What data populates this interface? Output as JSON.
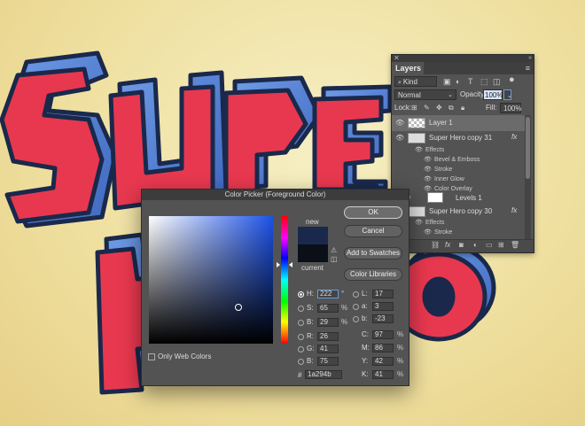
{
  "canvas": {
    "background_color": "#f2e4a8",
    "artwork": "3d-super-hero-text-graphic"
  },
  "layers_panel": {
    "tab": "Layers",
    "kind_label": "Kind",
    "blend_mode": "Normal",
    "opacity_label": "Opacity:",
    "opacity_value": "100%",
    "lock_label": "Lock:",
    "fill_label": "Fill:",
    "fill_value": "100%",
    "layers": [
      {
        "name": "Layer 1",
        "selected": true
      },
      {
        "name": "Super Hero copy 31",
        "fx": "fx"
      },
      {
        "name": "Levels 1"
      },
      {
        "name": "Super Hero copy 30",
        "fx": "fx"
      }
    ],
    "effects_label": "Effects",
    "effects_31": [
      "Bevel & Emboss",
      "Stroke",
      "Inner Glow",
      "Color Overlay"
    ],
    "effects_30": [
      "Stroke"
    ]
  },
  "color_picker": {
    "title": "Color Picker (Foreground Color)",
    "new_label": "new",
    "current_label": "current",
    "new_color": "#1a294b",
    "current_color": "#0a0f18",
    "buttons": {
      "ok": "OK",
      "cancel": "Cancel",
      "add_to_swatches": "Add to Swatches",
      "color_libraries": "Color Libraries"
    },
    "only_web_colors": "Only Web Colors",
    "hsb": {
      "h_label": "H:",
      "h_value": "222",
      "h_unit": "°",
      "s_label": "S:",
      "s_value": "65",
      "s_unit": "%",
      "b_label": "B:",
      "b_value": "29",
      "b_unit": "%"
    },
    "rgb": {
      "r_label": "R:",
      "r_value": "26",
      "g_label": "G:",
      "g_value": "41",
      "b_label": "B:",
      "b_value": "75"
    },
    "lab": {
      "l_label": "L:",
      "l_value": "17",
      "a_label": "a:",
      "a_value": "3",
      "b_label": "b:",
      "b_value": "-23"
    },
    "cmyk": {
      "c_label": "C:",
      "c_value": "97",
      "m_label": "M:",
      "m_value": "86",
      "y_label": "Y:",
      "y_value": "42",
      "k_label": "K:",
      "k_value": "41",
      "unit": "%"
    },
    "hex_label": "#",
    "hex_value": "1a294b"
  }
}
